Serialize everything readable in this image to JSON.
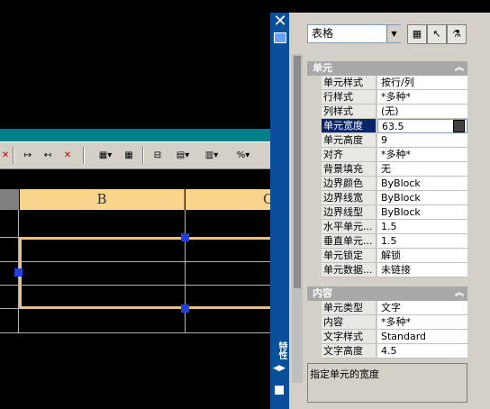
{
  "toolbar": {
    "items": [
      "✕",
      "↦",
      "↤",
      "✕",
      "▦▾",
      "▦",
      "⊟",
      "▤▾",
      "▥▾",
      "%▾"
    ]
  },
  "grid": {
    "columns": [
      "B",
      "C"
    ]
  },
  "palette": {
    "close_glyph": "✕",
    "vertical_label": "特性",
    "object_type": "表格",
    "categories": [
      {
        "title": "单元",
        "properties": [
          {
            "name": "单元样式",
            "value": "按行/列"
          },
          {
            "name": "行样式",
            "value": "*多种*"
          },
          {
            "name": "列样式",
            "value": "(无)"
          },
          {
            "name": "单元宽度",
            "value": "63.5"
          },
          {
            "name": "单元高度",
            "value": "9"
          },
          {
            "name": "对齐",
            "value": "*多种*"
          },
          {
            "name": "背景填充",
            "value": "无"
          },
          {
            "name": "边界颜色",
            "value": "ByBlock"
          },
          {
            "name": "边界线宽",
            "value": "ByBlock"
          },
          {
            "name": "边界线型",
            "value": "ByBlock"
          },
          {
            "name": "水平单元...",
            "value": "1.5"
          },
          {
            "name": "垂直单元...",
            "value": "1.5"
          },
          {
            "name": "单元锁定",
            "value": "解锁"
          },
          {
            "name": "单元数据...",
            "value": "未链接"
          }
        ]
      },
      {
        "title": "内容",
        "properties": [
          {
            "name": "单元类型",
            "value": "文字"
          },
          {
            "name": "内容",
            "value": "*多种*"
          },
          {
            "name": "文字样式",
            "value": "Standard"
          },
          {
            "name": "文字高度",
            "value": "4.5"
          }
        ]
      }
    ],
    "description": "指定单元的宽度",
    "colors": {
      "title_bar": "#0a4f9c",
      "selected_row": "#0a246a",
      "category": "#a8a8a8"
    }
  }
}
